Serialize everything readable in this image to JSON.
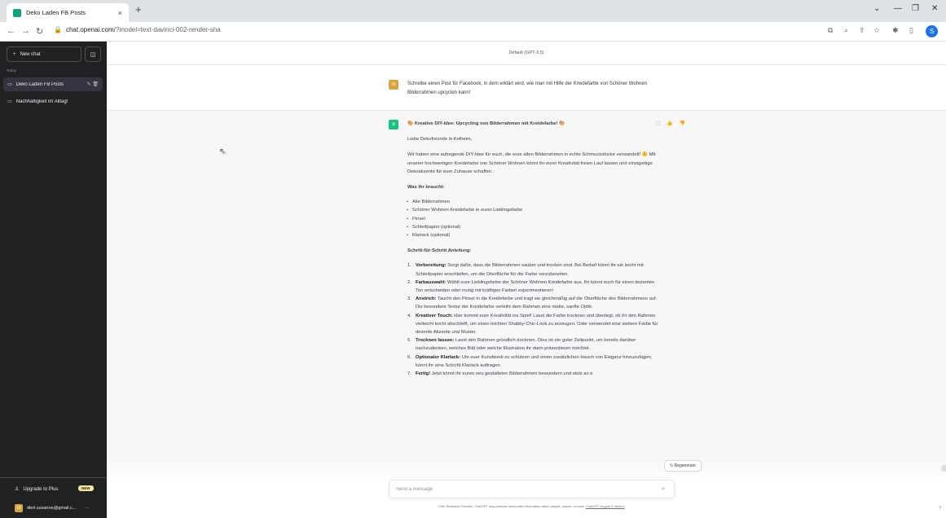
{
  "browser": {
    "tab_title": "Deko Laden FB Posts",
    "tab_close": "×",
    "new_tab": "+",
    "url_host": "chat.openai.com",
    "url_rest": "/?model=text-davinci-002-render-sha",
    "profile_initial": "S",
    "controls": {
      "chevron": "⌄",
      "minimize": "—",
      "restore": "❐",
      "close": "✕"
    }
  },
  "sidebar": {
    "new_chat_label": "New chat",
    "toggle_icon": "◫",
    "section_today": "Today",
    "conversations": [
      {
        "title": "Deko Laden FB Posts",
        "active": true
      },
      {
        "title": "Nachhaltigkeit im Alltag!",
        "active": false
      }
    ],
    "upgrade_label": "Upgrade to Plus",
    "new_badge": "NEW",
    "user_email": "dierl.susanne@gmail.c...",
    "user_initial": "DI",
    "user_more": "···"
  },
  "main": {
    "model_label": "Default (GPT-3.5)",
    "user_message": "Schreibe einen Post für Facebook, in dem erklärt wird, wie man mit Hilfe der Kreidefarbe von Schöner Wohnen Bilderrahmen upcyclen kann!",
    "bot": {
      "heading": "🎨 Kreative DIY-Idee: Upcycling von Bilderrahmen mit Kreidefarbe! 🎨",
      "greeting": "Liebe Dekofreunde in Kelheim,",
      "intro": "Wir haben eine aufregende DIY-Idee für euch, die eure alten Bilderrahmen in echte Schmuckstücke verwandelt! 🌼 Mit unserer hochwertigen Kreidefarbe von Schöner Wohnen könnt ihr eurer Kreativität freien Lauf lassen und einzigartige Dekoakzente für euer Zuhause schaffen.",
      "needs_heading": "Was ihr braucht:",
      "needs": [
        "Alte Bilderrahmen",
        "Schöner Wohnen Kreidefarbe in eurer Lieblingsfarbe",
        "Pinsel",
        "Schleifpapier (optional)",
        "Klarlack (optional)"
      ],
      "steps_heading": "Schritt-für-Schritt Anleitung:",
      "steps": [
        {
          "num": "1.",
          "title": "Vorbereitung:",
          "text": " Sorgt dafür, dass die Bilderrahmen sauber und trocken sind. Bei Bedarf könnt ihr sie leicht mit Schleifpapier anschleifen, um die Oberfläche für die Farbe vorzubereiten."
        },
        {
          "num": "2.",
          "title": "Farbauswahl:",
          "text": " Wählt eure Lieblingsfarbe der Schöner Wohnen Kreidefarbe aus. Ihr könnt euch für einen dezenten Ton entscheiden oder mutig mit kräftigen Farben experimentieren!"
        },
        {
          "num": "3.",
          "title": "Anstrich:",
          "text": " Taucht den Pinsel in die Kreidefarbe und tragt sie gleichmäßig auf die Oberfläche des Bilderrahmens auf. Die besondere Textur der Kreidefarbe verleiht dem Rahmen eine matte, sanfte Optik."
        },
        {
          "num": "4.",
          "title": "Kreativer Touch:",
          "text": " Hier kommt eure Kreativität ins Spiel! Lasst die Farbe trocknen und überlegt, ob ihr den Rahmen vielleicht leicht abschleift, um einen leichten Shabby-Chic-Look zu erzeugen. Oder verwendet eine weitere Farbe für dezente Akzente und Muster."
        },
        {
          "num": "5.",
          "title": "Trocknen lassen:",
          "text": " Lasst den Rahmen gründlich trocknen. Dies ist ein guter Zeitpunkt, um bereits darüber nachzudenken, welches Bild oder welche Illustration ihr darin präsentieren möchtet."
        },
        {
          "num": "6.",
          "title": "Optionaler Klarlack:",
          "text": " Um euer Kunstwerk zu schützen und einen zusätzlichen Hauch von Eleganz hinzuzufügen, könnt ihr eine Schicht Klarlack auftragen."
        },
        {
          "num": "7.",
          "title": "Fertig!",
          "text": " Jetzt könnt ihr euren neu gestalteten Bilderrahmen bewundern und stolz an e"
        }
      ]
    },
    "regenerate_label": "Regenerate",
    "input_placeholder": "Send a message",
    "disclaimer_text": "Free Research Preview. ChatGPT may produce inaccurate information about people, places, or facts. ",
    "disclaimer_link": "ChatGPT August 3 Version",
    "help": "?"
  }
}
